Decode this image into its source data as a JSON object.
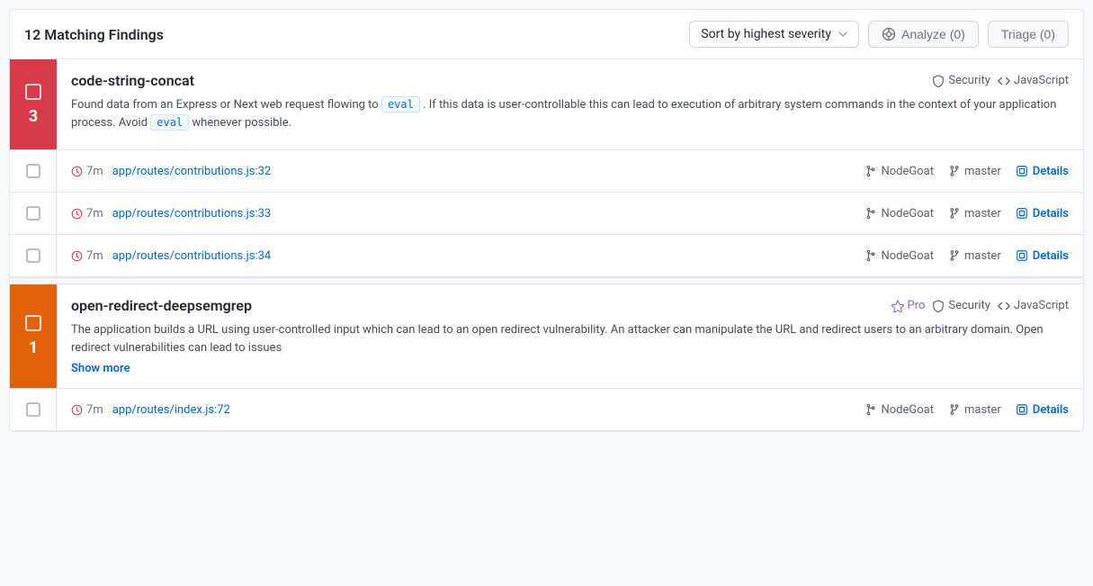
{
  "header": {
    "title": "12 Matching Findings",
    "sort_label": "Sort by highest severity",
    "analyze_label": "Analyze (0)",
    "triage_label": "Triage (0)"
  },
  "findings": [
    {
      "id": "finding-1",
      "severity_level": "3",
      "severity_color": "high",
      "name": "code-string-concat",
      "tags": [
        {
          "type": "security",
          "label": "Security"
        },
        {
          "type": "language",
          "label": "JavaScript"
        }
      ],
      "description_parts": [
        "Found data from an Express or Next web request flowing to ",
        "eval",
        ". If this data is user-controllable this can lead to execution of arbitrary system commands in the context of your application process. Avoid ",
        "eval",
        " whenever possible."
      ],
      "results": [
        {
          "time": "7m",
          "file": "app/routes/contributions.js:32",
          "repo": "NodeGoat",
          "branch": "master",
          "details_label": "Details"
        },
        {
          "time": "7m",
          "file": "app/routes/contributions.js:33",
          "repo": "NodeGoat",
          "branch": "master",
          "details_label": "Details"
        },
        {
          "time": "7m",
          "file": "app/routes/contributions.js:34",
          "repo": "NodeGoat",
          "branch": "master",
          "details_label": "Details"
        }
      ]
    },
    {
      "id": "finding-2",
      "severity_level": "1",
      "severity_color": "medium",
      "name": "open-redirect-deepsemgrep",
      "tags": [
        {
          "type": "pro",
          "label": "Pro"
        },
        {
          "type": "security",
          "label": "Security"
        },
        {
          "type": "language",
          "label": "JavaScript"
        }
      ],
      "description": "The application builds a URL using user-controlled input which can lead to an open redirect vulnerability. An attacker can manipulate the URL and redirect users to an arbitrary domain. Open redirect vulnerabilities can lead to issues",
      "show_more": true,
      "results": [
        {
          "time": "7m",
          "file": "app/routes/index.js:72",
          "repo": "NodeGoat",
          "branch": "master",
          "details_label": "Details"
        }
      ]
    }
  ],
  "icons": {
    "chevron": "⌄",
    "analyze": "⊙",
    "clock": "↺",
    "repo": "◎",
    "branch": "⑂",
    "details": "⧉",
    "shield": "🛡",
    "code": "</>",
    "pro_gem": "◈"
  }
}
